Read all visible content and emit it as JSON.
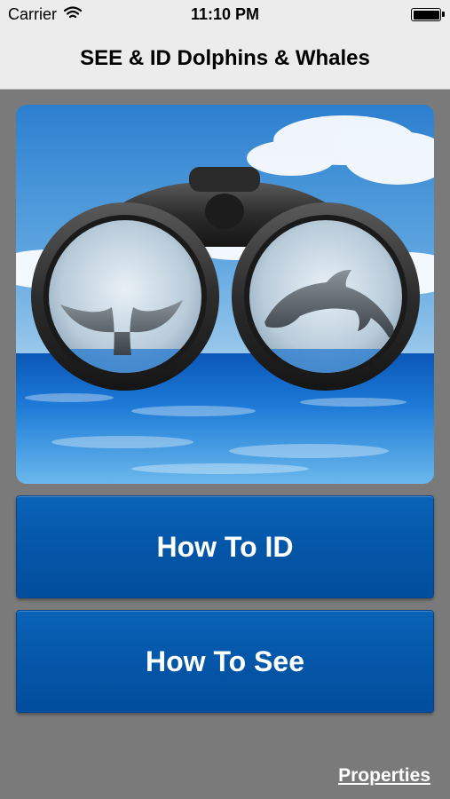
{
  "status_bar": {
    "carrier": "Carrier",
    "wifi_icon": "wifi-icon",
    "time": "11:10 PM",
    "battery_icon": "battery-full-icon"
  },
  "nav": {
    "title": "SEE & ID Dolphins & Whales"
  },
  "hero": {
    "image": "binoculars-whale-dolphin-illustration"
  },
  "buttons": {
    "how_to_id": "How To ID",
    "how_to_see": "How To See"
  },
  "footer": {
    "properties_link": "Properties"
  },
  "colors": {
    "background": "#7a7a7a",
    "nav_bar": "#ececec",
    "button_blue": "#0456a8",
    "link_text": "#ffffff"
  }
}
